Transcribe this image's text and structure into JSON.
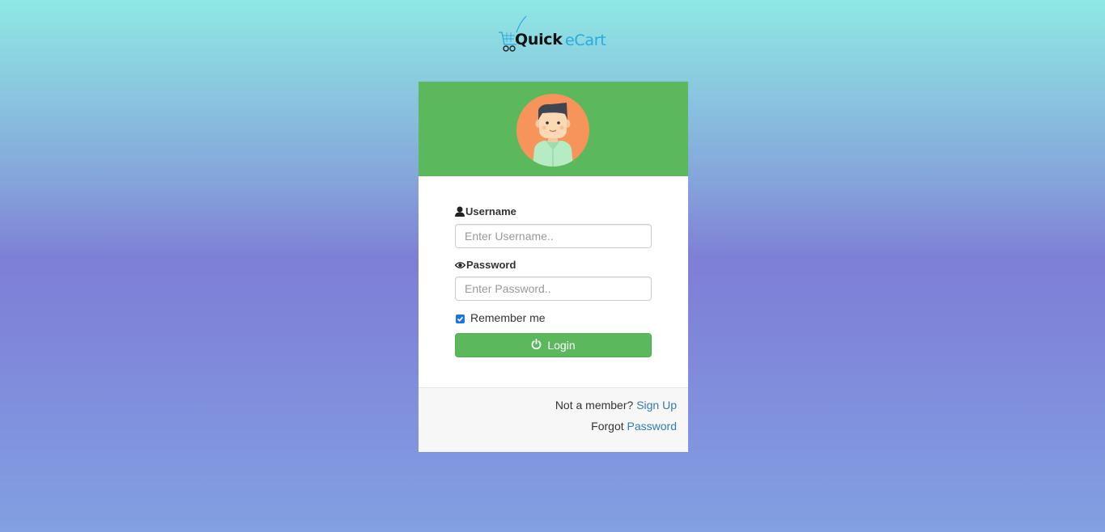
{
  "brand": {
    "word1": "Quick",
    "word2": "eCart",
    "word1_color": "#111111",
    "word2_color": "#2aa8e0",
    "icon": "shopping-cart-icon"
  },
  "header": {
    "background": "#5cb85c",
    "avatar_icon": "user-avatar-icon"
  },
  "form": {
    "username": {
      "label": "Username",
      "icon": "user-icon",
      "placeholder": "Enter Username..",
      "value": ""
    },
    "password": {
      "label": "Password",
      "icon": "eye-icon",
      "placeholder": "Enter Password..",
      "value": ""
    },
    "remember": {
      "label": "Remember me",
      "checked": true
    },
    "login_button": {
      "label": "Login",
      "icon": "power-icon",
      "color": "#5cb85c"
    }
  },
  "footer": {
    "signup_prefix": "Not a member? ",
    "signup_link": "Sign Up",
    "forgot_prefix": "Forgot ",
    "forgot_link": "Password",
    "link_color": "#337ab7"
  }
}
